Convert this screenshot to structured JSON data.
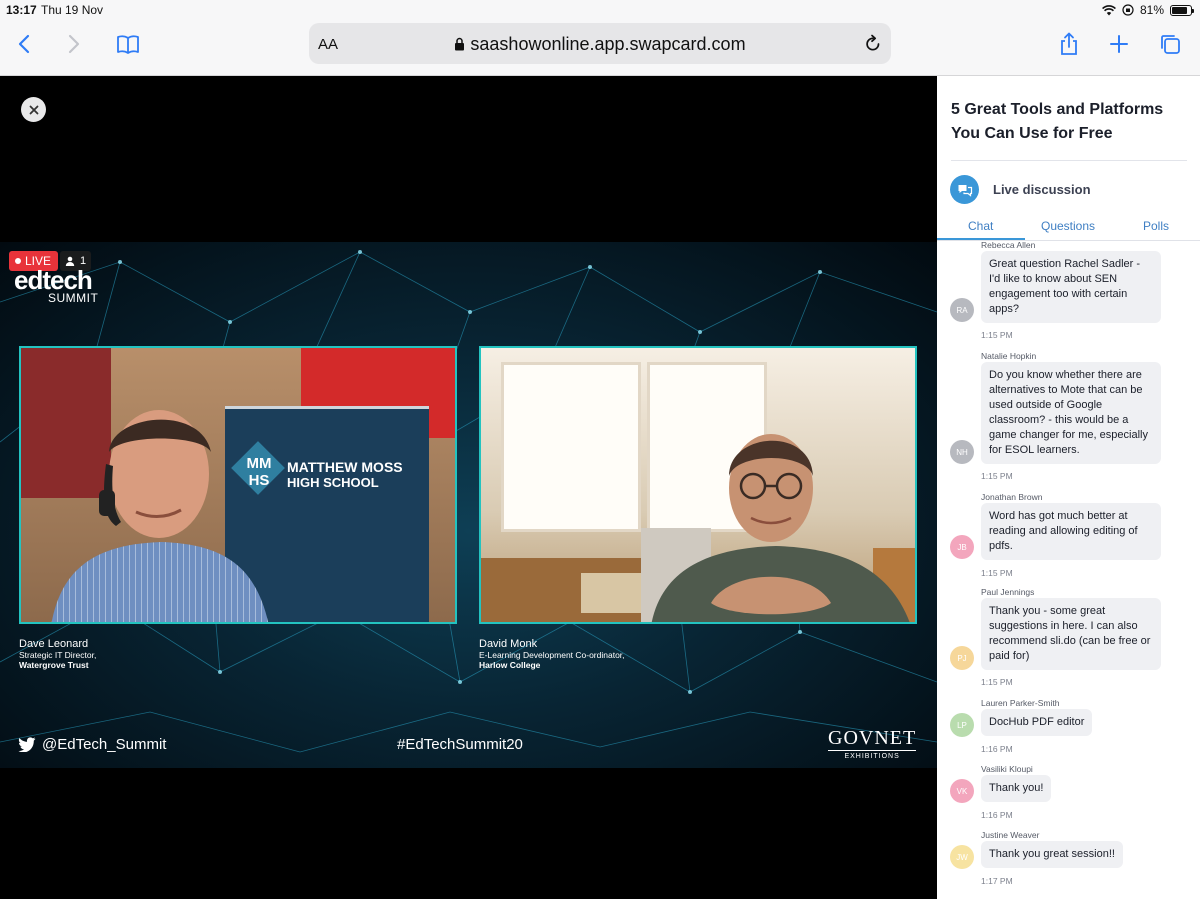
{
  "status_bar": {
    "time": "13:17",
    "date": "Thu 19 Nov",
    "battery": "81%",
    "battery_level": 0.81
  },
  "browser": {
    "text_size_label": "AA",
    "url": "saashowonline.app.swapcard.com"
  },
  "stream": {
    "live_label": "LIVE",
    "viewer_count": "1",
    "logo_top": "edtech",
    "logo_bottom": "SUMMIT",
    "booth_banner": {
      "initials": "MM HS",
      "line1": "MATTHEW MOSS",
      "line2": "HIGH SCHOOL"
    },
    "speakers": [
      {
        "name": "Dave Leonard",
        "role": "Strategic IT Director,",
        "org": "Watergrove Trust"
      },
      {
        "name": "David Monk",
        "role": "E-Learning Development Co-ordinator,",
        "org": "Harlow College"
      }
    ],
    "twitter_handle": "@EdTech_Summit",
    "hashtag": "#EdTechSummit20",
    "sponsor_name": "GovNet",
    "sponsor_sub": "EXHIBITIONS"
  },
  "sidebar": {
    "session_title": "5 Great Tools and Platforms You Can Use for Free",
    "discussion_label": "Live discussion",
    "tabs": [
      "Chat",
      "Questions",
      "Polls"
    ],
    "messages": [
      {
        "author": "Rebecca Allen",
        "initials": "RA",
        "avatar_color": "#b7b9bf",
        "text": "Great question Rachel Sadler - I'd like to know about SEN engagement too with certain apps?",
        "time": "1:15 PM"
      },
      {
        "author": "Natalie Hopkin",
        "initials": "NH",
        "avatar_color": "#b7b9bf",
        "text": "Do you know whether there are alternatives to Mote that can be used outside of Google classroom? - this would be a game changer for me, especially for ESOL learners.",
        "time": "1:15 PM"
      },
      {
        "author": "Jonathan Brown",
        "initials": "JB",
        "avatar_color": "#f3a6bd",
        "text": "Word has got much better at reading and allowing editing of pdfs.",
        "time": "1:15 PM"
      },
      {
        "author": "Paul Jennings",
        "initials": "PJ",
        "avatar_color": "#f6d79a",
        "text": "Thank you - some great suggestions in here. I can also recommend sli.do (can be free or paid for)",
        "time": "1:15 PM"
      },
      {
        "author": "Lauren Parker-Smith",
        "initials": "LP",
        "avatar_color": "#b9dcae",
        "text": "DocHub PDF editor",
        "time": "1:16 PM"
      },
      {
        "author": "Vasiliki Kloupi",
        "initials": "VK",
        "avatar_color": "#f3a6bd",
        "text": "Thank you!",
        "time": "1:16 PM"
      },
      {
        "author": "Justine Weaver",
        "initials": "JW",
        "avatar_color": "#f7e3a1",
        "text": "Thank you great session!!",
        "time": "1:17 PM"
      }
    ]
  }
}
